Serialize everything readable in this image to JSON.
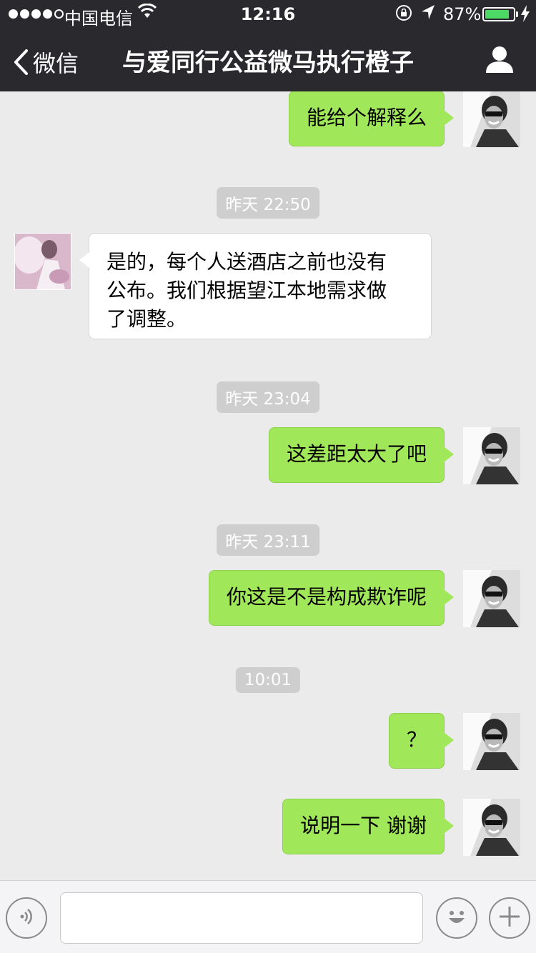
{
  "status_bar": {
    "carrier": "中国电信",
    "time": "12:16",
    "battery_percent": "87%",
    "battery_level": 0.87,
    "signal_bars_filled": 4,
    "signal_bars_total": 5,
    "battery_color": "#4cd964"
  },
  "nav": {
    "back_label": "微信",
    "title": "与爱同行公益微马执行橙子"
  },
  "messages": [
    {
      "type": "message",
      "sender": "me",
      "text": "能给个解释么"
    },
    {
      "type": "timestamp",
      "text": "昨天 22:50"
    },
    {
      "type": "message",
      "sender": "other",
      "lines": [
        "是的，每个人送酒店之前也没有",
        "公布。我们根据望江本地需求做",
        "了调整。"
      ]
    },
    {
      "type": "timestamp",
      "text": "昨天 23:04"
    },
    {
      "type": "message",
      "sender": "me",
      "text": "这差距太大了吧"
    },
    {
      "type": "timestamp",
      "text": "昨天 23:11"
    },
    {
      "type": "message",
      "sender": "me",
      "text": "你这是不是构成欺诈呢"
    },
    {
      "type": "timestamp",
      "text": "10:01"
    },
    {
      "type": "message",
      "sender": "me",
      "text": "？"
    },
    {
      "type": "message",
      "sender": "me",
      "text": "说明一下 谢谢"
    }
  ],
  "input_bar": {
    "voice_icon": "voice-icon",
    "emoji_icon": "emoji-icon",
    "plus_icon": "plus-icon",
    "text_value": ""
  },
  "colors": {
    "bubble_me": "#a0e75a",
    "bubble_other": "#ffffff",
    "header_bg": "#2a2a2e",
    "chat_bg": "#ebebeb",
    "timestamp_bg": "#cecece"
  }
}
